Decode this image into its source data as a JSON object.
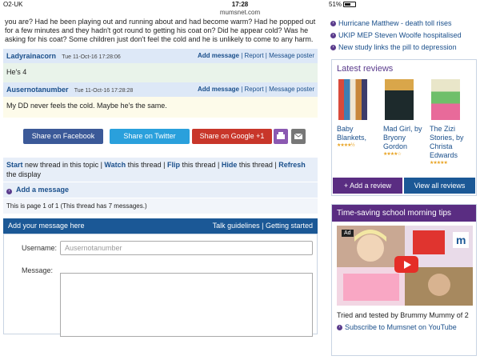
{
  "status": {
    "carrier": "O2-UK",
    "time": "17:28",
    "battery": "51%"
  },
  "url": "mumsnet.com",
  "thread": {
    "intro": "you are? Had he been playing out and running about and had become warm? Had he popped out for a few minutes and they hadn't got round to getting his coat on? Did he appear cold? Was he asking for his coat? Some children just don't feel the cold and he is unlikely to come to any harm.",
    "posts": [
      {
        "author": "Ladyrainacorn",
        "date": "Tue 11-Oct-16 17:28:06",
        "body": "He's 4"
      },
      {
        "author": "Ausernotanumber",
        "date": "Tue 11-Oct-16 17:28:28",
        "body": "My DD never feels the cold. Maybe he's the same."
      }
    ],
    "post_links": {
      "add": "Add message",
      "report": "Report",
      "poster": "Message poster"
    }
  },
  "share": {
    "facebook": "Share on Facebook",
    "twitter": "Share on Twitter",
    "google": "Share on Google +1"
  },
  "actions": {
    "start": "Start",
    "start_rest": " new thread in this topic | ",
    "watch": "Watch",
    "watch_rest": " this thread | ",
    "flip": "Flip",
    "flip_rest": " this thread | ",
    "hide": "Hide",
    "hide_rest": " this thread | ",
    "refresh": "Refresh",
    "refresh_rest": " the display"
  },
  "add_message": "Add a message",
  "page_info": "This is page 1 of 1 (This thread has 7 messages.)",
  "form": {
    "title": "Add your message here",
    "guidelines": "Talk guidelines",
    "started": "Getting started",
    "username_label": "Username:",
    "username_value": "Ausernotanumber",
    "message_label": "Message:"
  },
  "news": [
    "Hurricane Matthew - death toll rises",
    "UKIP MEP Steven Woolfe hospitalised",
    "New study links the pill to depression"
  ],
  "reviews": {
    "title": "Latest reviews",
    "books": [
      {
        "title1": "Baby",
        "title2": "Blankets,",
        "title3": "",
        "title4": "",
        "stars": "★★★★½"
      },
      {
        "title1": "Mad Girl, by",
        "title2": "Bryony",
        "title3": "Gordon",
        "title4": "",
        "stars": "★★★★☆"
      },
      {
        "title1": "The Zizi",
        "title2": "Stories, by",
        "title3": "Christa",
        "title4": "Edwards",
        "stars": "★★★★★"
      }
    ],
    "add": "+ Add a review",
    "view_all": "View all reviews"
  },
  "tips": {
    "title": "Time-saving school morning tips",
    "ad": "Ad",
    "caption": "Tried and tested by Brummy Mummy of 2",
    "subscribe": "Subscribe to Mumsnet on YouTube"
  }
}
